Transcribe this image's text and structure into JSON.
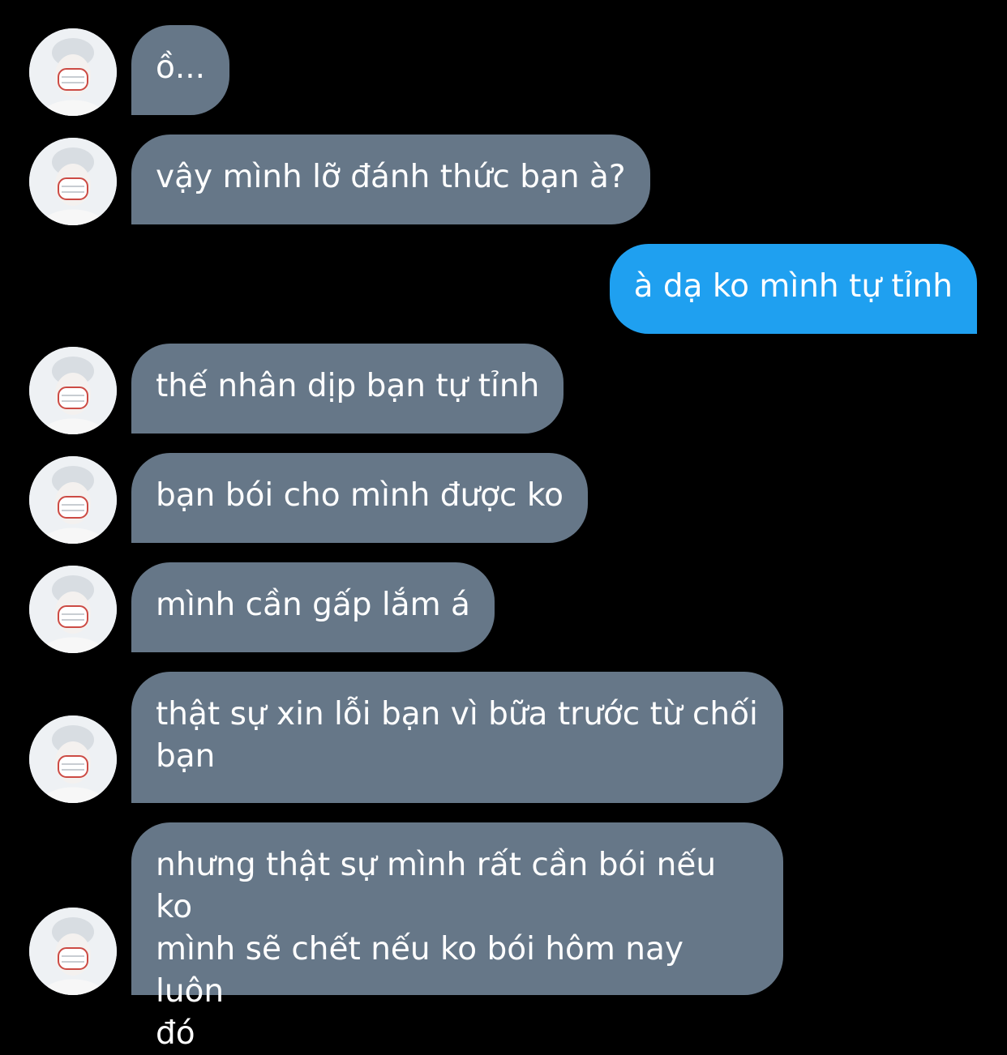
{
  "messages": [
    {
      "direction": "in",
      "lines": [
        "ồ..."
      ]
    },
    {
      "direction": "in",
      "lines": [
        "vậy mình lỡ đánh thức bạn à?"
      ]
    },
    {
      "direction": "out",
      "lines": [
        "à dạ ko mình tự tỉnh"
      ]
    },
    {
      "direction": "in",
      "lines": [
        "thế nhân dịp bạn tự tỉnh"
      ]
    },
    {
      "direction": "in",
      "lines": [
        "bạn bói cho mình được ko"
      ]
    },
    {
      "direction": "in",
      "lines": [
        "mình cần gấp lắm á"
      ]
    },
    {
      "direction": "in",
      "lines": [
        "thật sự xin lỗi bạn vì bữa trước từ chối",
        "bạn"
      ]
    },
    {
      "direction": "in",
      "lines": [
        "nhưng thật sự mình rất cần bói nếu ko",
        "mình sẽ chết nếu ko bói hôm nay luôn",
        "đó"
      ]
    }
  ],
  "colors": {
    "background": "#000000",
    "incoming_bubble": "#667788",
    "outgoing_bubble": "#1fa0f0",
    "text": "#ffffff"
  },
  "icons": {
    "avatar": "avatar-icon"
  }
}
